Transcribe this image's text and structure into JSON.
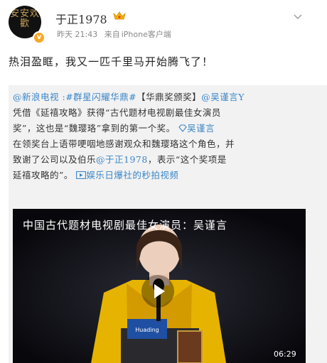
{
  "post": {
    "username": "于正1978",
    "time": "昨天 21:43",
    "source_prefix": "来自",
    "source_client": "iPhone客户端",
    "text": "热泪盈眶，我又一匹千里马开始腾飞了！"
  },
  "avatar": {
    "calligraphy": "安安欢歡"
  },
  "repost": {
    "mention_sina": "@新浪电视",
    "hashtag": ":#群星闪耀华鼎#",
    "award_tag": "【华鼎奖颁奖】",
    "mention_wu": "@吴谨言Y",
    "line1": "凭借《延禧攻略》获得“古代题材电视剧最佳女演员",
    "line2a": "奖”，这也是“魏璎珞”拿到的第一个奖。",
    "mention_wu2": "吴谨言",
    "line3": "在领奖台上语带哽咽地感谢观众和魏璎珞这个角色，并",
    "line4a": "致谢了公司以及伯乐",
    "mention_yu": "@于正1978",
    "line4b": "，表示“这个奖项是",
    "line5a": "延禧攻略的”。",
    "video_link": "娱乐日爆社的秒拍视频"
  },
  "video": {
    "caption": "中国古代题材电视剧最佳女演员：吴谨言",
    "duration": "06:29",
    "trophy_label": "Huading"
  },
  "colors": {
    "link": "#eb7350",
    "mention_blue": "#3b86c7",
    "verified": "#f9a825"
  }
}
